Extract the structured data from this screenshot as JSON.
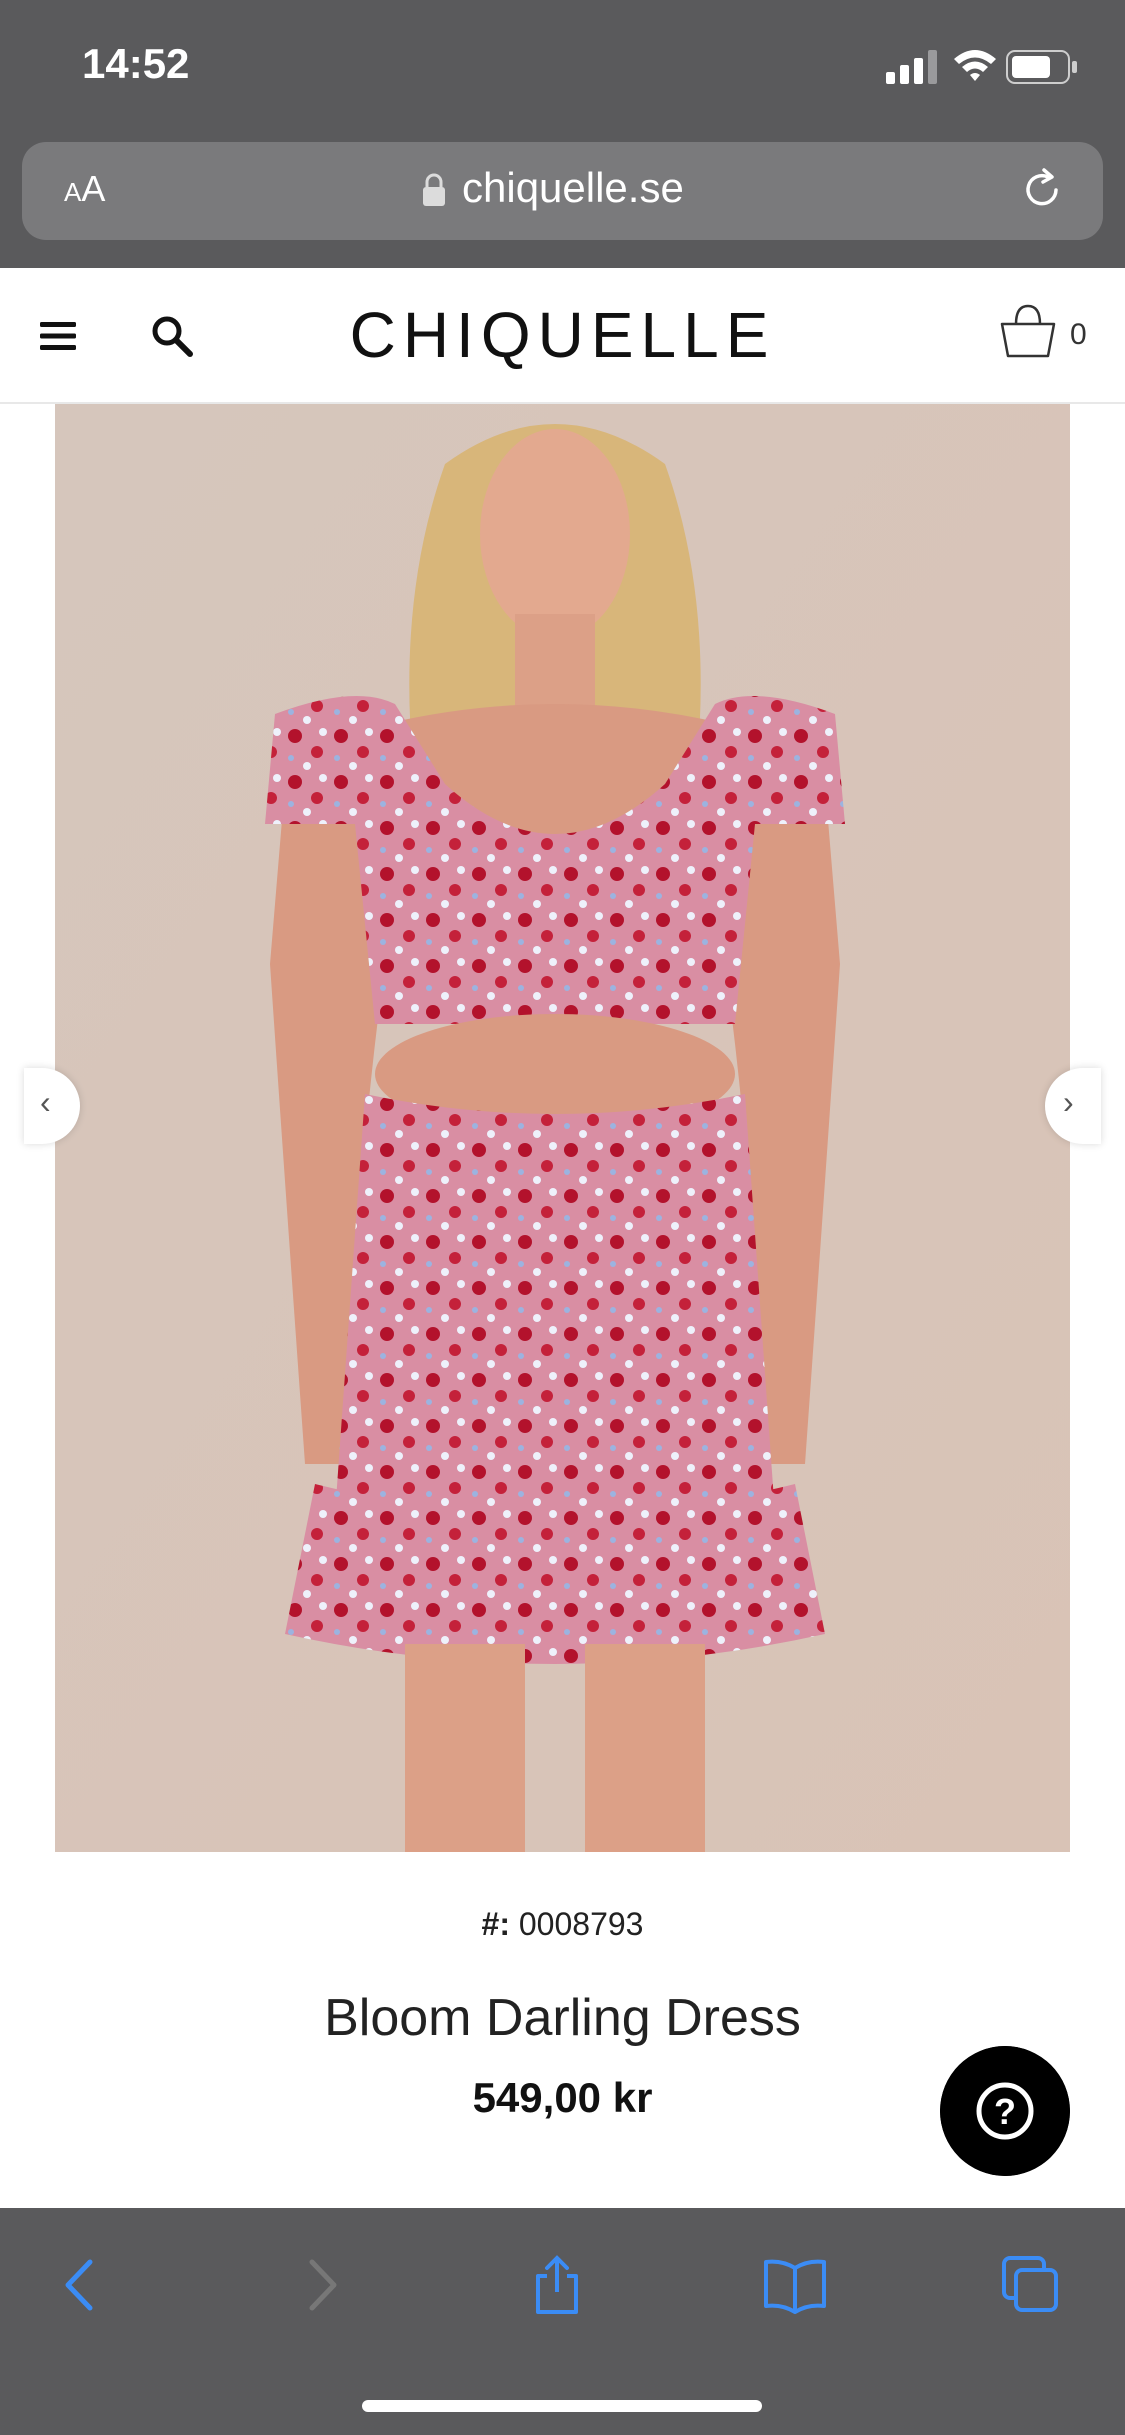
{
  "status_bar": {
    "time": "14:52"
  },
  "browser": {
    "text_size_small": "A",
    "text_size_large": "A",
    "domain": "chiquelle.se"
  },
  "site": {
    "logo": "CHIQUELLE",
    "cart_count": "0"
  },
  "product": {
    "sku_label": "#:",
    "sku": "0008793",
    "name": "Bloom Darling Dress",
    "price": "549,00 kr"
  },
  "carousel": {
    "prev": "‹",
    "next": "›"
  },
  "help": {
    "label": "?"
  },
  "colors": {
    "toolbar_bg": "#5a5a5c",
    "accent_blue": "#3b8cf5",
    "text_dark": "#111111"
  },
  "icons": [
    "signal-icon",
    "wifi-icon",
    "battery-icon",
    "lock-icon",
    "reload-icon",
    "menu-icon",
    "search-icon",
    "cart-icon",
    "help-icon",
    "back-icon",
    "forward-icon",
    "share-icon",
    "bookmarks-icon",
    "tabs-icon"
  ]
}
